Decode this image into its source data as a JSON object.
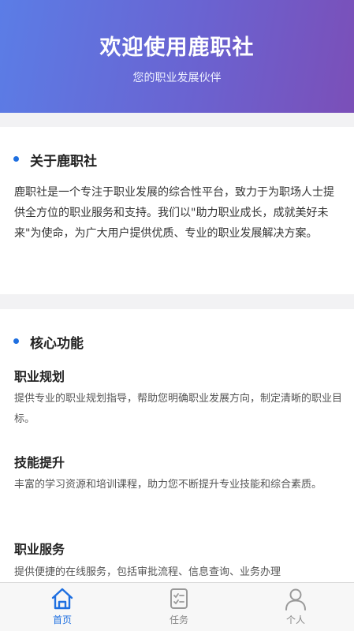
{
  "header": {
    "title": "欢迎使用鹿职社",
    "subtitle": "您的职业发展伙伴"
  },
  "about": {
    "title": "关于鹿职社",
    "text": "鹿职社是一个专注于职业发展的综合性平台，致力于为职场人士提供全方位的职业服务和支持。我们以\"助力职业成长，成就美好未来\"为使命，为广大用户提供优质、专业的职业发展解决方案。"
  },
  "features": {
    "title": "核心功能",
    "items": [
      {
        "title": "职业规划",
        "desc": "提供专业的职业规划指导，帮助您明确职业发展方向，制定清晰的职业目标。"
      },
      {
        "title": "技能提升",
        "desc": "丰富的学习资源和培训课程，助力您不断提升专业技能和综合素质。"
      },
      {
        "title": "职业服务",
        "desc": "提供便捷的在线服务，包括审批流程、信息查询、业务办理"
      }
    ]
  },
  "tabbar": {
    "items": [
      {
        "label": "首页",
        "icon": "home-icon",
        "active": true
      },
      {
        "label": "任务",
        "icon": "task-list-icon",
        "active": false
      },
      {
        "label": "个人",
        "icon": "user-icon",
        "active": false
      }
    ]
  },
  "colors": {
    "accent": "#1e6fe0",
    "header_gradient_start": "#5b7de6",
    "header_gradient_end": "#7b4fb8"
  }
}
